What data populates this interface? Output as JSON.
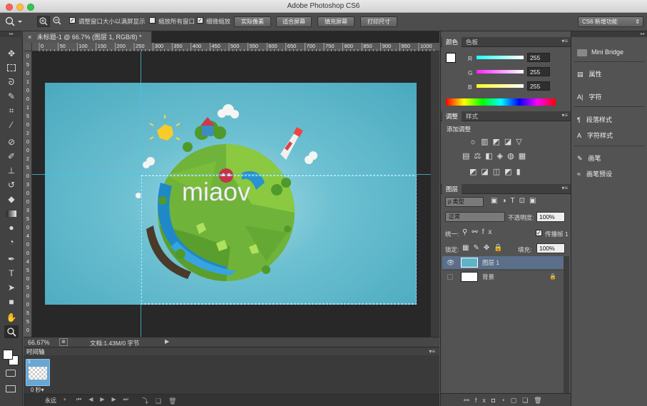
{
  "window": {
    "title": "Adobe Photoshop CS6",
    "workspace": "CS6 新增功能"
  },
  "options": {
    "resize_label": "调整窗口大小以满屏显示",
    "zoom_all_label": "缩放所有窗口",
    "scrubby_label": "细微缩放",
    "actual_pixels": "实际像素",
    "fit_screen": "适合屏幕",
    "fill_screen": "填充屏幕",
    "print_size": "打印尺寸"
  },
  "document": {
    "tab": "未标题-1 @ 66.7% (图层 1, RGB/8) *",
    "zoom": "66.67%",
    "doc_info": "文档:1.43M/0 字节",
    "artwork_text": "miaov"
  },
  "ruler": {
    "h": [
      "0",
      "50",
      "100",
      "150",
      "200",
      "250",
      "300",
      "350",
      "400",
      "450",
      "500",
      "550",
      "600",
      "650",
      "700",
      "750",
      "800",
      "850",
      "900",
      "950",
      "1000"
    ],
    "v": [
      "0",
      "5",
      "0",
      "1",
      "0",
      "0",
      "1",
      "5",
      "0",
      "2",
      "0",
      "0",
      "2",
      "5",
      "0",
      "3",
      "0",
      "0",
      "3",
      "5",
      "0",
      "4",
      "0",
      "0",
      "4",
      "5",
      "0",
      "5",
      "0",
      "0",
      "5",
      "5",
      "0"
    ]
  },
  "timeline": {
    "title": "时间轴",
    "frame_num": "1",
    "frame_time": "0 秒▾",
    "loop": "永远"
  },
  "color_panel": {
    "tabs": [
      "颜色",
      "色板"
    ],
    "r_label": "R",
    "g_label": "G",
    "b_label": "B",
    "r": "255",
    "g": "255",
    "b": "255"
  },
  "adjust_panel": {
    "tabs": [
      "调整",
      "样式"
    ],
    "title": "添加调整"
  },
  "layers_panel": {
    "tab": "图层",
    "filter": "ρ 类型",
    "blend": "正常",
    "opacity_label": "不透明度:",
    "opacity": "100%",
    "unify_label": "统一:",
    "propagate_label": "传播帧 1",
    "lock_label": "锁定:",
    "fill_label": "填充:",
    "fill": "100%",
    "layers": [
      {
        "name": "图层 1"
      },
      {
        "name": "背景"
      }
    ]
  },
  "right_dock": {
    "items": [
      "Mini Bridge",
      "属性",
      "字符",
      "段落样式",
      "字符样式",
      "画笔",
      "画笔预设"
    ]
  },
  "colors": {
    "canvas_bg": "#5db4c6",
    "accent": "#3b86d6"
  }
}
